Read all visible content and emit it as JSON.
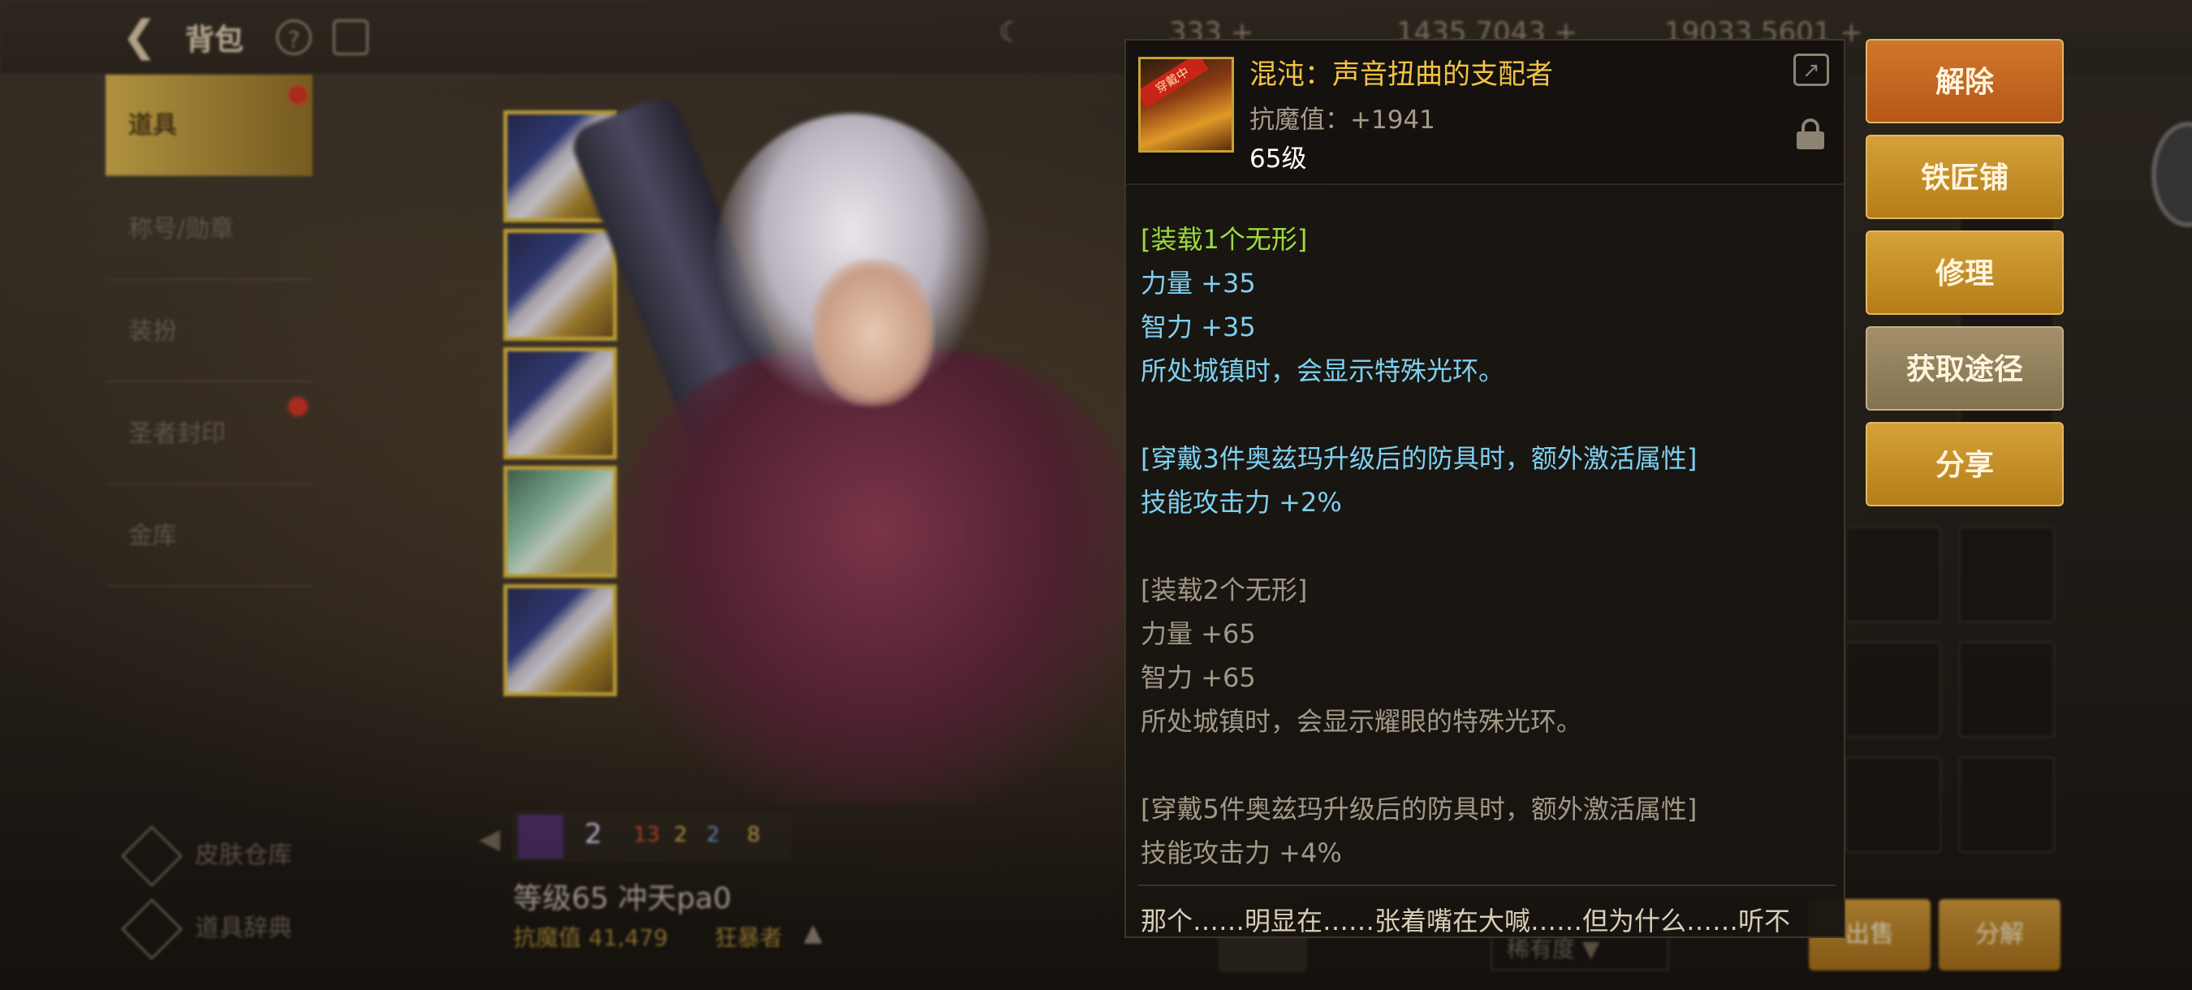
{
  "header": {
    "title": "背包",
    "currencies": [
      "333 +",
      "1435 7043 +",
      "19033 5601 +"
    ]
  },
  "sidebar": {
    "items": [
      {
        "label": "道具",
        "active": true,
        "badge": true
      },
      {
        "label": "称号/勋章",
        "active": false,
        "badge": false
      },
      {
        "label": "装扮",
        "active": false,
        "badge": false
      },
      {
        "label": "圣者封印",
        "active": false,
        "badge": true
      },
      {
        "label": "金库",
        "active": false,
        "badge": false
      }
    ],
    "bottom": [
      "皮肤仓库",
      "道具辞典"
    ]
  },
  "character": {
    "name": "等级65 冲天pa0",
    "power_label": "抗魔值 41,479",
    "job": "狂暴者",
    "stats": [
      "2",
      "13",
      "2",
      "2",
      "8"
    ]
  },
  "tooltip": {
    "item_name": "混沌：声音扭曲的支配者",
    "icon_ribbon": "穿戴中",
    "resist": "抗魔值：+1941",
    "level": "65级",
    "lines": [
      {
        "text": "[装载1个无形]",
        "color": "green"
      },
      {
        "text": "力量 +35",
        "color": "blue"
      },
      {
        "text": "智力 +35",
        "color": "blue"
      },
      {
        "text": "所处城镇时，会显示特殊光环。",
        "color": "blue"
      },
      {
        "text": "",
        "color": "blank"
      },
      {
        "text": "[穿戴3件奥兹玛升级后的防具时，额外激活属性]",
        "color": "blue"
      },
      {
        "text": "技能攻击力 +2%",
        "color": "blue"
      },
      {
        "text": "",
        "color": "blank"
      },
      {
        "text": "[装载2个无形]",
        "color": "grey"
      },
      {
        "text": "力量 +65",
        "color": "grey"
      },
      {
        "text": "智力 +65",
        "color": "grey"
      },
      {
        "text": "所处城镇时，会显示耀眼的特殊光环。",
        "color": "grey"
      },
      {
        "text": "",
        "color": "blank"
      },
      {
        "text": "[穿戴5件奥兹玛升级后的防具时，额外激活属性]",
        "color": "grey"
      },
      {
        "text": "技能攻击力 +4%",
        "color": "grey"
      }
    ],
    "flavor": "那个……明显在……张着嘴在大喊……但为什么……听不"
  },
  "actions": {
    "release": "解除",
    "blacksmith": "铁匠铺",
    "repair": "修理",
    "obtain": "获取途径",
    "share": "分享"
  },
  "footer": {
    "sell": "出售",
    "split": "分解",
    "rarity": "稀有度"
  },
  "colors": {
    "accent_gold": "#d5a13a",
    "accent_orange": "#d0772c",
    "text_green": "#9cdb3e",
    "text_blue": "#7fd0f0",
    "text_grey": "#a29886",
    "item_name": "#f3c247"
  }
}
